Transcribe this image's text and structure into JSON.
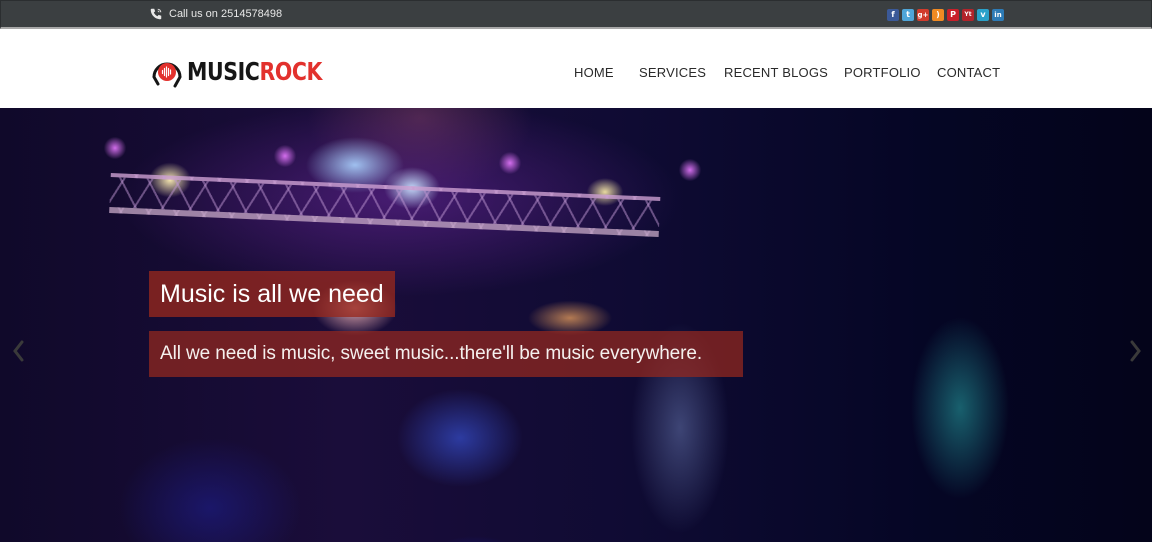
{
  "topbar": {
    "phone_icon": "phone-icon",
    "phone_text": "Call us on 2514578498",
    "social": [
      {
        "name": "facebook",
        "icon": "facebook-icon",
        "glyph": "f",
        "color": "#3b5998"
      },
      {
        "name": "twitter",
        "icon": "twitter-icon",
        "glyph": "t",
        "color": "#4fa5d8"
      },
      {
        "name": "google-plus",
        "icon": "google-plus-icon",
        "glyph": "g+",
        "color": "#d13b2c"
      },
      {
        "name": "rss",
        "icon": "rss-icon",
        "glyph": ")",
        "color": "#f08a23"
      },
      {
        "name": "pinterest",
        "icon": "pinterest-icon",
        "glyph": "P",
        "color": "#c9202a"
      },
      {
        "name": "youtube",
        "icon": "youtube-icon",
        "glyph": "Yt",
        "color": "#b3242b"
      },
      {
        "name": "vimeo",
        "icon": "vimeo-icon",
        "glyph": "v",
        "color": "#2aa1c9"
      },
      {
        "name": "linkedin",
        "icon": "linkedin-icon",
        "glyph": "in",
        "color": "#2d7bb6"
      }
    ]
  },
  "header": {
    "logo": {
      "part1": "MUSIC",
      "part2": "ROCK",
      "accent": "#e2312d"
    },
    "nav": [
      {
        "label": "HOME"
      },
      {
        "label": "SERVICES"
      },
      {
        "label": "RECENT BLOGS"
      },
      {
        "label": "PORTFOLIO"
      },
      {
        "label": "CONTACT"
      }
    ]
  },
  "hero": {
    "title": "Music is all we need",
    "subtitle": "All we need is music, sweet music...there'll be music everywhere.",
    "caption_bg": "#962820",
    "prev_icon": "chevron-left-icon",
    "next_icon": "chevron-right-icon"
  }
}
